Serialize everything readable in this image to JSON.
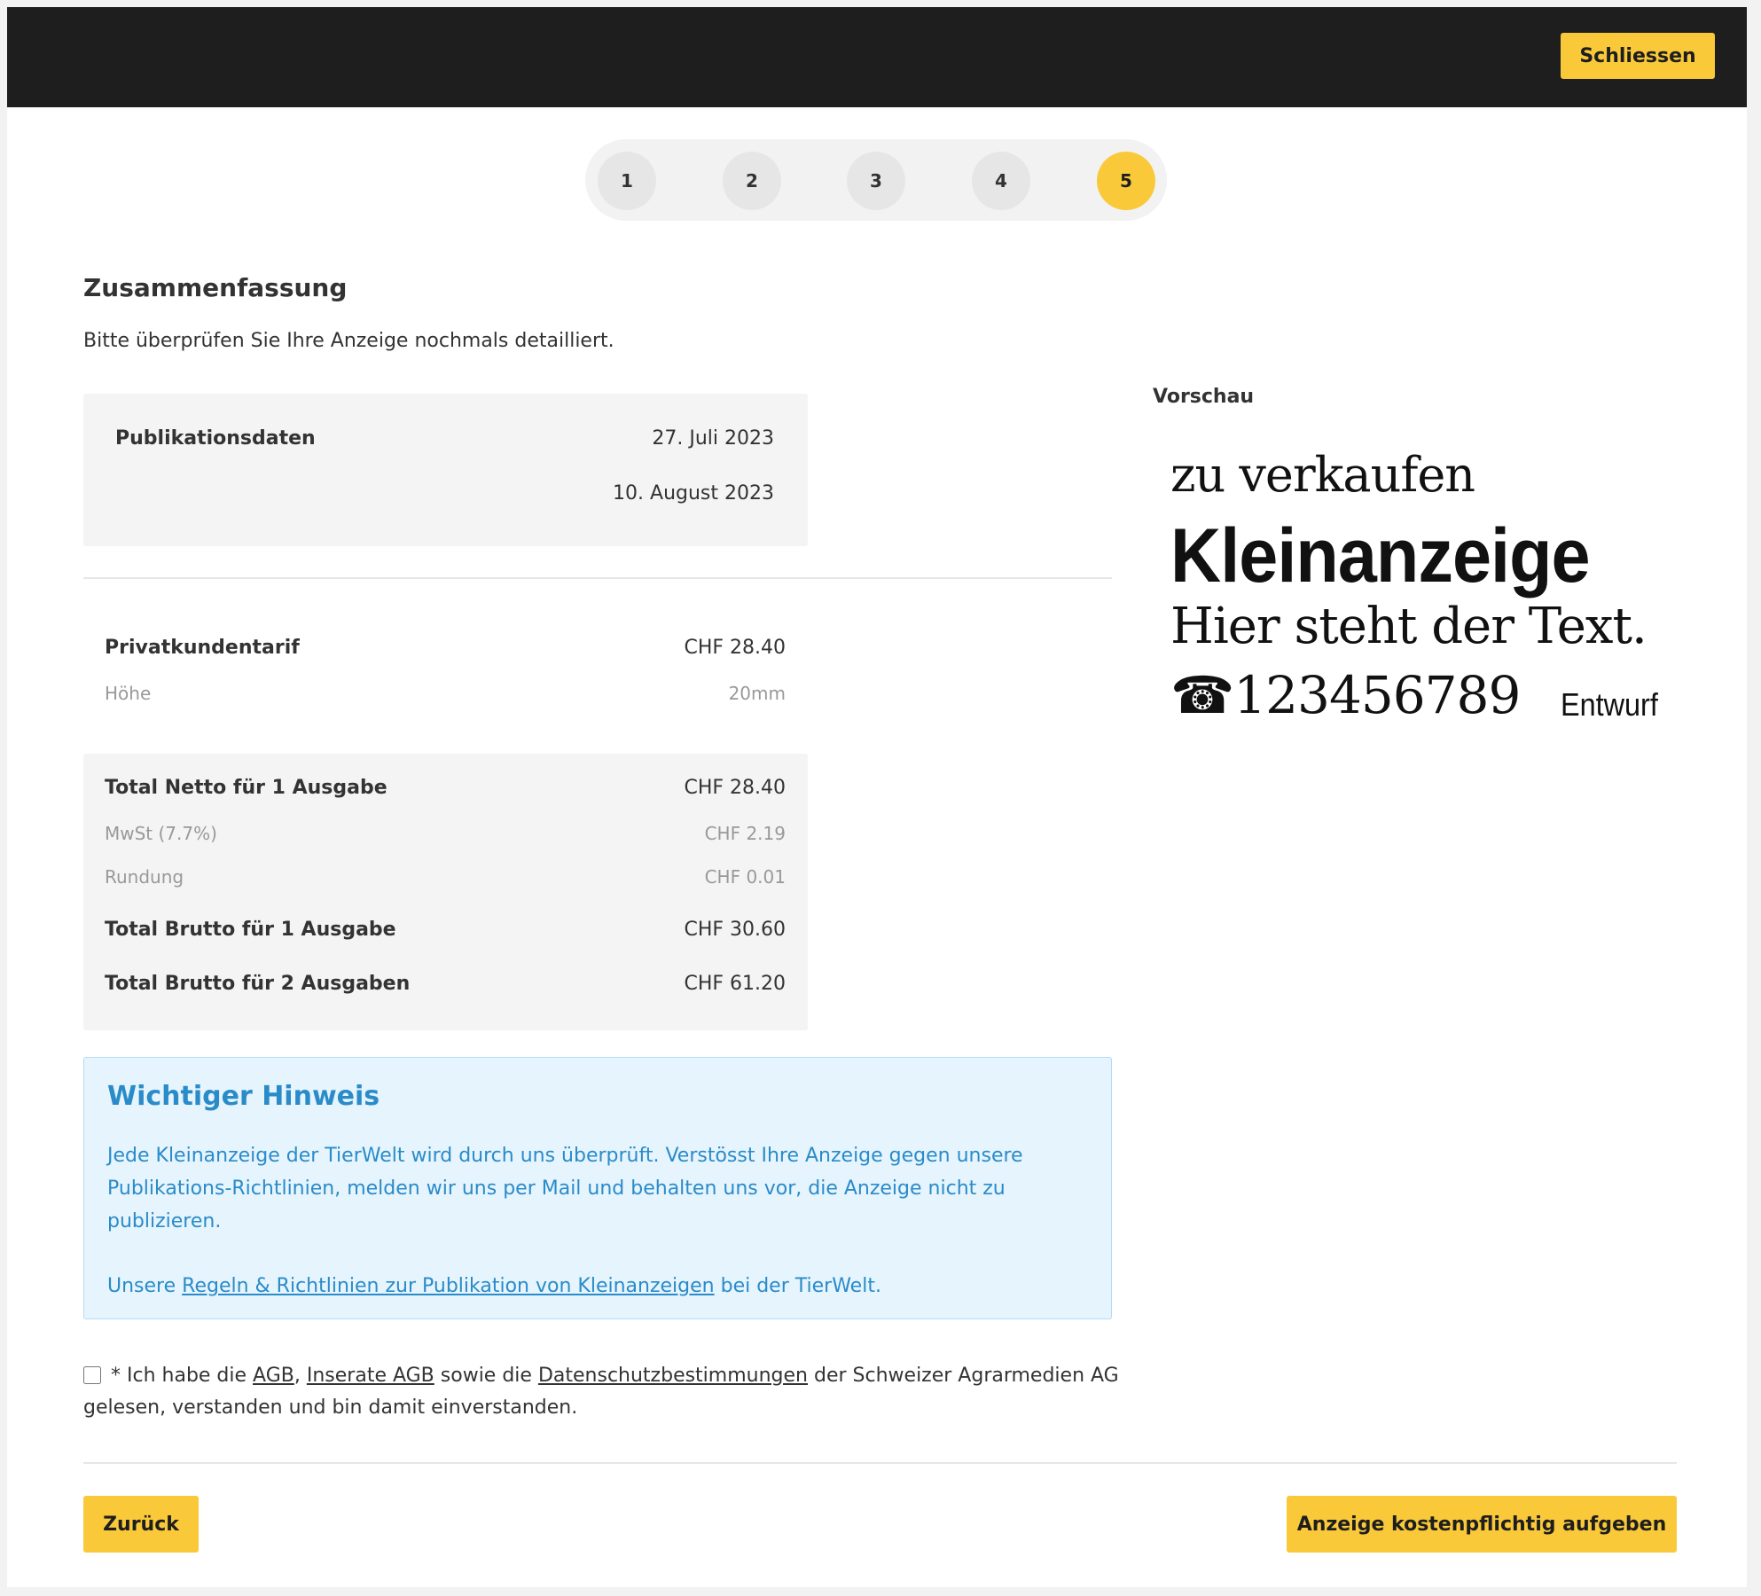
{
  "header": {
    "close_label": "Schliessen"
  },
  "stepper": {
    "steps": [
      "1",
      "2",
      "3",
      "4",
      "5"
    ],
    "active": "5"
  },
  "summary": {
    "title": "Zusammenfassung",
    "intro": "Bitte überprüfen Sie Ihre Anzeige nochmals detailliert."
  },
  "publication": {
    "label": "Publikationsdaten",
    "dates": [
      "27. Juli 2023",
      "10. August 2023"
    ]
  },
  "tariff": {
    "label": "Privatkundentarif",
    "value": "CHF 28.40",
    "height_label": "Höhe",
    "height_value": "20mm"
  },
  "totals": {
    "net_label": "Total Netto für 1 Ausgabe",
    "net_value": "CHF 28.40",
    "vat_label": "MwSt (7.7%)",
    "vat_value": "CHF 2.19",
    "rounding_label": "Rundung",
    "rounding_value": "CHF 0.01",
    "gross1_label": "Total Brutto für 1 Ausgabe",
    "gross1_value": "CHF 30.60",
    "gross2_label": "Total Brutto für 2 Ausgaben",
    "gross2_value": "CHF 61.20"
  },
  "notice": {
    "title": "Wichtiger Hinweis",
    "text": "Jede Kleinanzeige der TierWelt wird durch uns überprüft. Verstösst Ihre Anzeige gegen unsere Publikations-Richtlinien, melden wir uns per Mail und behalten uns vor, die Anzeige nicht zu publizieren.",
    "prefix": "Unsere",
    "link": "Regeln & Richtlinien zur Publikation von Kleinanzeigen",
    "suffix": "bei der TierWelt."
  },
  "consent": {
    "t1": "* Ich habe die",
    "link1": "AGB",
    "t2": ",",
    "link2": "Inserate AGB",
    "t3": "sowie die",
    "link3": "Datenschutzbestimmungen",
    "t4": "der Schweizer Agrarmedien AG gelesen, verstanden und bin damit einverstanden.",
    "checked": false
  },
  "footer": {
    "back_label": "Zurück",
    "submit_label": "Anzeige kostenpflichtig aufgeben"
  },
  "preview": {
    "label": "Vorschau",
    "line1": "zu verkaufen",
    "line2": "Kleinanzeige",
    "line3": "Hier steht der Text.",
    "phone_icon": "☎",
    "phone": "123456789",
    "draft": "Entwurf"
  },
  "colors": {
    "accent": "#f9c93a",
    "topbar": "#1e1e1e",
    "notice_blue": "#2a8bc9",
    "notice_bg": "#e6f4fd"
  }
}
